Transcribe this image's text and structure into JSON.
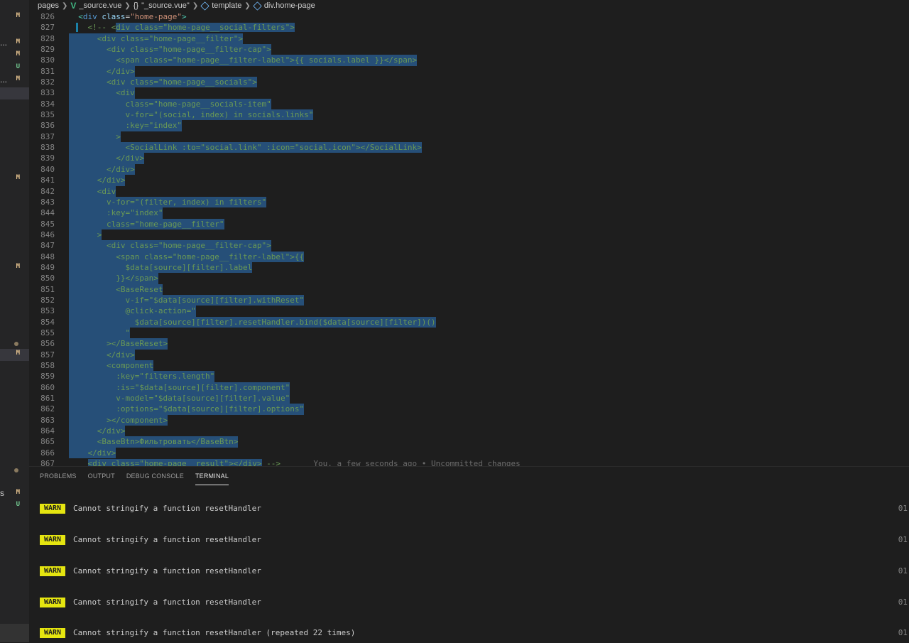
{
  "breadcrumb": {
    "folder": "pages",
    "file": "_source.vue",
    "braces": "{}",
    "symbol_file": "\"_source.vue\"",
    "template": "template",
    "element": "div.home-page"
  },
  "sidebar": {
    "items": [
      {
        "dots": "",
        "status": "M",
        "status_color": "#e2c08d",
        "selected": false
      },
      {
        "dots": "...",
        "status": "M",
        "status_color": "#e2c08d",
        "selected": false
      },
      {
        "dots": "",
        "status": "M",
        "status_color": "#e2c08d",
        "selected": false
      },
      {
        "dots": "",
        "status": "U",
        "status_color": "#73c991",
        "selected": false
      },
      {
        "dots": "...",
        "status": "M",
        "status_color": "#e2c08d",
        "selected": false
      },
      {
        "dots": "",
        "status": "M",
        "status_color": "#e2c08d",
        "selected": false
      },
      {
        "dots": "",
        "status": "M",
        "status_color": "#e2c08d",
        "selected": false
      },
      {
        "dots": "",
        "status": "M",
        "status_color": "#e2c08d",
        "selected": true
      },
      {
        "dots": "s",
        "status": "M",
        "status_color": "#e2c08d",
        "selected": false
      },
      {
        "dots": "",
        "status": "U",
        "status_color": "#73c991",
        "selected": false
      }
    ]
  },
  "editor": {
    "lines": [
      {
        "n": "826",
        "sel": false,
        "html": "<span class=\"ind\">  </span><span class=\"tag\">&lt;</span><span class=\"tagname\">div</span> <span class=\"attr\">class</span><span class=\"txt\">=</span><span class=\"str\">\"home-page\"</span><span class=\"tag\">&gt;</span>"
      },
      {
        "n": "827",
        "sel": false,
        "marker": true,
        "html": "<span class=\"ind\">    </span><span class=\"cmt\">&lt;!-- &lt;</span><span class=\"sel\"><span class=\"cmt\">div class=\"home-page__social-filters\"&gt;</span></span>"
      },
      {
        "n": "828",
        "sel": true,
        "html": "<span class=\"txt\">      &lt;div class=\"home-page__filter\"&gt;</span>"
      },
      {
        "n": "829",
        "sel": true,
        "html": "<span class=\"txt\">        &lt;div class=\"home-page__filter-cap\"&gt;</span>"
      },
      {
        "n": "830",
        "sel": true,
        "html": "<span class=\"txt\">          &lt;span class=\"home-page__filter-label\"&gt;{{ socials.label }}&lt;/span&gt;</span>"
      },
      {
        "n": "831",
        "sel": true,
        "html": "<span class=\"txt\">        &lt;/div&gt;</span>"
      },
      {
        "n": "832",
        "sel": true,
        "html": "<span class=\"txt\">        &lt;div class=\"home-page__socials\"&gt;</span>"
      },
      {
        "n": "833",
        "sel": true,
        "html": "<span class=\"txt\">          &lt;div</span>"
      },
      {
        "n": "834",
        "sel": true,
        "html": "<span class=\"txt\">            class=\"home-page__socials-item\"</span>"
      },
      {
        "n": "835",
        "sel": true,
        "html": "<span class=\"txt\">            v-for=\"(social, index) in socials.links\"</span>"
      },
      {
        "n": "836",
        "sel": true,
        "html": "<span class=\"txt\">            :key=\"index\"</span>"
      },
      {
        "n": "837",
        "sel": true,
        "html": "<span class=\"txt\">          &gt;</span>"
      },
      {
        "n": "838",
        "sel": true,
        "html": "<span class=\"txt\">            &lt;SocialLink :to=\"social.link\" :icon=\"social.icon\"&gt;&lt;/SocialLink&gt;</span>"
      },
      {
        "n": "839",
        "sel": true,
        "html": "<span class=\"txt\">          &lt;/div&gt;</span>"
      },
      {
        "n": "840",
        "sel": true,
        "html": "<span class=\"txt\">        &lt;/div&gt;</span>"
      },
      {
        "n": "841",
        "sel": true,
        "html": "<span class=\"txt\">      &lt;/div&gt;</span>"
      },
      {
        "n": "842",
        "sel": true,
        "html": "<span class=\"txt\">      &lt;div</span>"
      },
      {
        "n": "843",
        "sel": true,
        "html": "<span class=\"txt\">        v-for=\"(filter, index) in filters\"</span>"
      },
      {
        "n": "844",
        "sel": true,
        "html": "<span class=\"txt\">        :key=\"index\"</span>"
      },
      {
        "n": "845",
        "sel": true,
        "html": "<span class=\"txt\">        class=\"home-page__filter\"</span>"
      },
      {
        "n": "846",
        "sel": true,
        "html": "<span class=\"txt\">      &gt;</span>"
      },
      {
        "n": "847",
        "sel": true,
        "html": "<span class=\"txt\">        &lt;div class=\"home-page__filter-cap\"&gt;</span>"
      },
      {
        "n": "848",
        "sel": true,
        "html": "<span class=\"txt\">          &lt;span class=\"home-page__filter-label\"&gt;{{</span>"
      },
      {
        "n": "849",
        "sel": true,
        "html": "<span class=\"txt\">            $data[source][filter].label</span>"
      },
      {
        "n": "850",
        "sel": true,
        "html": "<span class=\"txt\">          }}&lt;/span&gt;</span>"
      },
      {
        "n": "851",
        "sel": true,
        "html": "<span class=\"txt\">          &lt;BaseReset</span>"
      },
      {
        "n": "852",
        "sel": true,
        "html": "<span class=\"txt\">            v-if=\"$data[source][filter].withReset\"</span>"
      },
      {
        "n": "853",
        "sel": true,
        "html": "<span class=\"txt\">            @click-action=\"</span>"
      },
      {
        "n": "854",
        "sel": true,
        "html": "<span class=\"txt\">              $data[source][filter].resetHandler.bind($data[source][filter])()</span>"
      },
      {
        "n": "855",
        "sel": true,
        "html": "<span class=\"txt\">            \"</span>"
      },
      {
        "n": "856",
        "sel": true,
        "html": "<span class=\"txt\">        &gt;&lt;/BaseReset&gt;</span>"
      },
      {
        "n": "857",
        "sel": true,
        "html": "<span class=\"txt\">        &lt;/div&gt;</span>"
      },
      {
        "n": "858",
        "sel": true,
        "html": "<span class=\"txt\">        &lt;component</span>"
      },
      {
        "n": "859",
        "sel": true,
        "html": "<span class=\"txt\">          :key=\"filters.length\"</span>"
      },
      {
        "n": "860",
        "sel": true,
        "html": "<span class=\"txt\">          :is=\"$data[source][filter].component\"</span>"
      },
      {
        "n": "861",
        "sel": true,
        "html": "<span class=\"txt\">          v-model=\"$data[source][filter].value\"</span>"
      },
      {
        "n": "862",
        "sel": true,
        "html": "<span class=\"txt\">          :options=\"$data[source][filter].options\"</span>"
      },
      {
        "n": "863",
        "sel": true,
        "html": "<span class=\"txt\">        &gt;&lt;/component&gt;</span>"
      },
      {
        "n": "864",
        "sel": true,
        "html": "<span class=\"txt\">      &lt;/div&gt;</span>"
      },
      {
        "n": "865",
        "sel": true,
        "html": "<span class=\"txt\">      &lt;BaseBtn&gt;Фильтровать&lt;/BaseBtn&gt;</span>"
      },
      {
        "n": "866",
        "sel": true,
        "html": "<span class=\"txt\">    &lt;/div&gt;</span>"
      },
      {
        "n": "867",
        "sel": false,
        "html": "<span class=\"ind\">    </span><span class=\"sel\"><span class=\"cmt\">&lt;div class=\"home-page__result\"&gt;&lt;/div&gt;</span></span><span class=\"cmt\"> --&gt;</span><span class=\"blame\">       You, a few seconds ago • Uncommitted changes</span>"
      }
    ]
  },
  "panel": {
    "tabs": [
      {
        "label": "PROBLEMS",
        "active": false
      },
      {
        "label": "OUTPUT",
        "active": false
      },
      {
        "label": "DEBUG CONSOLE",
        "active": false
      },
      {
        "label": "TERMINAL",
        "active": true
      }
    ],
    "logs": [
      {
        "level": "WARN",
        "message": "Cannot stringify a function resetHandler",
        "time": "01"
      },
      {
        "level": "WARN",
        "message": "Cannot stringify a function resetHandler",
        "time": "01"
      },
      {
        "level": "WARN",
        "message": "Cannot stringify a function resetHandler",
        "time": "01"
      },
      {
        "level": "WARN",
        "message": "Cannot stringify a function resetHandler",
        "time": "01"
      },
      {
        "level": "WARN",
        "message": "Cannot stringify a function resetHandler (repeated 22 times)",
        "time": "01"
      }
    ]
  }
}
